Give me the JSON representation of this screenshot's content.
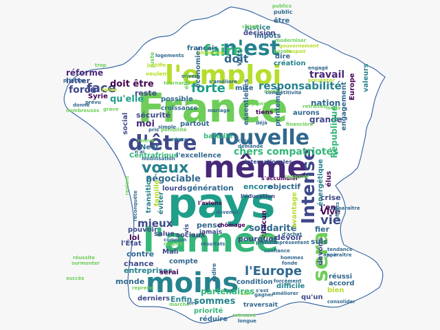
{
  "map": {
    "outline_color": "#3b6aa5",
    "fill": "#ffffff",
    "background": "#f7f7f8"
  },
  "palette": [
    "#440154",
    "#482878",
    "#3e4989",
    "#31688e",
    "#26828e",
    "#1f9e89",
    "#35b779",
    "#6ece58",
    "#b5de2b",
    "#fde725"
  ],
  "words": [
    {
      "text": "France",
      "color": "#6ece58"
    },
    {
      "text": "pays",
      "color": "#1f9e89"
    },
    {
      "text": "l'année",
      "color": "#35b779"
    },
    {
      "text": "même",
      "color": "#482878"
    },
    {
      "text": "l'emploi",
      "color": "#b5de2b"
    },
    {
      "text": "moins",
      "color": "#26828e"
    },
    {
      "text": "nouvelle",
      "color": "#31688e"
    },
    {
      "text": "d'être",
      "color": "#3e4989"
    },
    {
      "text": "n'est",
      "color": "#26828e"
    },
    {
      "text": "sera",
      "color": "#6ece58"
    },
    {
      "text": "Intense",
      "color": "#3e4989"
    },
    {
      "text": "vœux",
      "color": "#26828e"
    },
    {
      "text": "faire",
      "color": "#35b779"
    },
    {
      "text": "face",
      "color": "#3e4989"
    },
    {
      "text": "forte",
      "color": "#1f9e89"
    },
    {
      "text": "doit",
      "color": "#31688e"
    },
    {
      "text": "responsabilité",
      "color": "#26828e"
    },
    {
      "text": "l'Europe",
      "color": "#31688e"
    },
    {
      "text": "chers compatriotes",
      "color": "#35b779"
    },
    {
      "text": "négociable",
      "color": "#31688e"
    },
    {
      "text": "vie",
      "color": "#3e4989"
    },
    {
      "text": "mieux",
      "color": "#3e4989"
    },
    {
      "text": "sommes",
      "color": "#26828e"
    },
    {
      "text": "solidarité",
      "color": "#31688e"
    },
    {
      "text": "partenaires",
      "color": "#35b779"
    },
    {
      "text": "réforme",
      "color": "#482878"
    },
    {
      "text": "doit être",
      "color": "#440154"
    },
    {
      "text": "qu'elle",
      "color": "#1f9e89"
    },
    {
      "text": "force",
      "color": "#3e4989"
    },
    {
      "text": "moi",
      "color": "#482878"
    },
    {
      "text": "travail",
      "color": "#482878"
    },
    {
      "text": "Europe",
      "color": "#440154"
    },
    {
      "text": "nation",
      "color": "#31688e"
    },
    {
      "text": "grande",
      "color": "#3e4989"
    },
    {
      "text": "République",
      "color": "#35b779"
    },
    {
      "text": "sécurité",
      "color": "#3e4989"
    },
    {
      "text": "génération",
      "color": "#31688e"
    },
    {
      "text": "pense",
      "color": "#31688e"
    },
    {
      "text": "pourquoi",
      "color": "#3e4989"
    },
    {
      "text": "encore",
      "color": "#26828e"
    },
    {
      "text": "objectif",
      "color": "#31688e"
    },
    {
      "text": "crise",
      "color": "#3e4989"
    },
    {
      "text": "j'en",
      "color": "#440154"
    },
    {
      "text": "fier",
      "color": "#31688e"
    },
    {
      "text": "Vive",
      "color": "#440154"
    },
    {
      "text": "devoir",
      "color": "#3e4989"
    },
    {
      "text": "suis",
      "color": "#31688e"
    },
    {
      "text": "avantage",
      "color": "#b5de2b"
    },
    {
      "text": "élus",
      "color": "#440154"
    },
    {
      "text": "bataille",
      "color": "#35b779"
    },
    {
      "text": "partout",
      "color": "#31688e"
    },
    {
      "text": "Neuf",
      "color": "#31688e"
    },
    {
      "text": "Centrafrique",
      "color": "#35b779"
    },
    {
      "text": "l'excellence",
      "color": "#31688e"
    },
    {
      "text": "monde",
      "color": "#31688e"
    },
    {
      "text": "Enfin",
      "color": "#26828e"
    },
    {
      "text": "chance",
      "color": "#3e4989"
    },
    {
      "text": "entreprises",
      "color": "#26828e"
    },
    {
      "text": "compte",
      "color": "#31688e"
    },
    {
      "text": "contre",
      "color": "#31688e"
    },
    {
      "text": "loi",
      "color": "#440154"
    },
    {
      "text": "lourds",
      "color": "#3e4989"
    },
    {
      "text": "éviter",
      "color": "#26828e"
    },
    {
      "text": "transition",
      "color": "#26828e"
    },
    {
      "text": "famille",
      "color": "#b5de2b"
    },
    {
      "text": "énergétique",
      "color": "#26828e"
    },
    {
      "text": "chacun",
      "color": "#440154"
    },
    {
      "text": "devons",
      "color": "#3e4989"
    },
    {
      "text": "réussi",
      "color": "#31688e"
    },
    {
      "text": "accord",
      "color": "#31688e"
    },
    {
      "text": "difficile",
      "color": "#26828e"
    },
    {
      "text": "condition",
      "color": "#31688e"
    },
    {
      "text": "qu'un",
      "color": "#3e4989"
    },
    {
      "text": "bien",
      "color": "#b5de2b"
    },
    {
      "text": "derniers",
      "color": "#3e4989"
    },
    {
      "text": "priorité",
      "color": "#35b779"
    },
    {
      "text": "réduire",
      "color": "#31688e"
    },
    {
      "text": "reste",
      "color": "#3e4989"
    },
    {
      "text": "lutter",
      "color": "#3e4989"
    },
    {
      "text": "justice",
      "color": "#26828e"
    },
    {
      "text": "impôts",
      "color": "#31688e"
    },
    {
      "text": "décision",
      "color": "#3e4989"
    },
    {
      "text": "création",
      "color": "#26828e"
    },
    {
      "text": "économies",
      "color": "#31688e"
    },
    {
      "text": "français",
      "color": "#31688e"
    },
    {
      "text": "vers",
      "color": "#31688e"
    },
    {
      "text": "être",
      "color": "#31688e"
    },
    {
      "text": "dire",
      "color": "#31688e"
    },
    {
      "text": "possible",
      "color": "#31688e"
    },
    {
      "text": "social",
      "color": "#3e4989"
    },
    {
      "text": "serai",
      "color": "#440154"
    },
    {
      "text": "salue",
      "color": "#3e4989"
    },
    {
      "text": "Mali",
      "color": "#3e4989"
    },
    {
      "text": "sociaux",
      "color": "#3e4989"
    },
    {
      "text": "aurons",
      "color": "#31688e"
    },
    {
      "text": "essentielles",
      "color": "#31688e"
    },
    {
      "text": "printemps",
      "color": "#31688e"
    },
    {
      "text": "engagement",
      "color": "#31688e"
    },
    {
      "text": "Syrie",
      "color": "#440154"
    },
    {
      "text": "l'État",
      "color": "#3e4989"
    },
    {
      "text": "pouvoir",
      "color": "#3e4989"
    },
    {
      "text": "vis",
      "color": "#3e4989"
    },
    {
      "text": "jamais",
      "color": "#3e4989"
    },
    {
      "text": "l'avions",
      "color": "#440154"
    },
    {
      "text": "l'éducation",
      "color": "#3e4989"
    },
    {
      "text": "internationales",
      "color": "#3e4989"
    },
    {
      "text": "mise",
      "color": "#31688e"
    },
    {
      "text": "valeurs",
      "color": "#26828e"
    },
    {
      "text": "chômage",
      "color": "#440154"
    },
    {
      "text": "croissance",
      "color": "#31688e"
    },
    {
      "text": "public",
      "color": "#31688e"
    },
    {
      "text": "publics",
      "color": "#6ece58"
    },
    {
      "text": "mieux",
      "color": "#26828e"
    },
    {
      "text": "moderniser",
      "color": "#6ece58"
    },
    {
      "text": "gouvernement",
      "color": "#b5de2b"
    },
    {
      "text": "besoin",
      "color": "#6ece58"
    },
    {
      "text": "l'espoir",
      "color": "#b5de2b"
    },
    {
      "text": "engagé",
      "color": "#31688e"
    },
    {
      "text": "présenter",
      "color": "#b5de2b"
    },
    {
      "text": "principe",
      "color": "#31688e"
    },
    {
      "text": "donné",
      "color": "#31688e"
    },
    {
      "text": "trop",
      "color": "#6ece58"
    },
    {
      "text": "grave",
      "color": "#6ece58"
    },
    {
      "text": "nombreuses",
      "color": "#6ece58"
    },
    {
      "text": "retraites",
      "color": "#6ece58"
    },
    {
      "text": "longs",
      "color": "#6ece58"
    },
    {
      "text": "tendance",
      "color": "#31688e"
    },
    {
      "text": "apparaître",
      "color": "#31688e"
    },
    {
      "text": "consolider",
      "color": "#31688e"
    },
    {
      "text": "améliorer",
      "color": "#31688e"
    },
    {
      "text": "forcément",
      "color": "#31688e"
    },
    {
      "text": "marché",
      "color": "#6ece58"
    },
    {
      "text": "reprend",
      "color": "#6ece58"
    },
    {
      "text": "longue",
      "color": "#31688e"
    },
    {
      "text": "retrouvé",
      "color": "#6ece58"
    },
    {
      "text": "traversait",
      "color": "#31688e"
    },
    {
      "text": "soir",
      "color": "#6ece58"
    },
    {
      "text": "financière",
      "color": "#6ece58"
    },
    {
      "text": "tiens",
      "color": "#440154"
    },
    {
      "text": "mariage",
      "color": "#31688e"
    },
    {
      "text": "plans",
      "color": "#6ece58"
    },
    {
      "text": "début",
      "color": "#6ece58"
    },
    {
      "text": "pénibilité",
      "color": "#6ece58"
    },
    {
      "text": "s'accumuler",
      "color": "#440154"
    },
    {
      "text": "représentent",
      "color": "#31688e"
    },
    {
      "text": "d'achat",
      "color": "#31688e"
    },
    {
      "text": "prenant",
      "color": "#31688e"
    },
    {
      "text": "résultats",
      "color": "#31688e"
    },
    {
      "text": "respire",
      "color": "#6ece58"
    },
    {
      "text": "surmonter",
      "color": "#6ece58"
    },
    {
      "text": "commun",
      "color": "#31688e"
    },
    {
      "text": "fonde",
      "color": "#31688e"
    },
    {
      "text": "s'améliore",
      "color": "#31688e"
    },
    {
      "text": "pris",
      "color": "#31688e"
    },
    {
      "text": "simple",
      "color": "#31688e"
    },
    {
      "text": "mobilisation",
      "color": "#31688e"
    },
    {
      "text": "n'ai",
      "color": "#31688e"
    },
    {
      "text": "revient",
      "color": "#6ece58"
    },
    {
      "text": "reconquête",
      "color": "#31688e"
    },
    {
      "text": "efforts",
      "color": "#31688e"
    },
    {
      "text": "regagner",
      "color": "#6ece58"
    },
    {
      "text": "gagner",
      "color": "#31688e"
    },
    {
      "text": "choix",
      "color": "#6ece58"
    },
    {
      "text": "confiance",
      "color": "#31688e"
    },
    {
      "text": "niveau",
      "color": "#6ece58"
    },
    {
      "text": "ouvert",
      "color": "#31688e"
    },
    {
      "text": "tournante",
      "color": "#6ece58"
    },
    {
      "text": "juste",
      "color": "#6ece58"
    },
    {
      "text": "veulent",
      "color": "#b5de2b"
    },
    {
      "text": "chômeurs",
      "color": "#b5de2b"
    },
    {
      "text": "élevé",
      "color": "#6ece58"
    },
    {
      "text": "logements",
      "color": "#31688e"
    },
    {
      "text": "justifie",
      "color": "#b5de2b"
    },
    {
      "text": "faible",
      "color": "#b5de2b"
    },
    {
      "text": "c'était",
      "color": "#6ece58"
    },
    {
      "text": "compétitivité",
      "color": "#31688e"
    },
    {
      "text": "demande",
      "color": "#31688e"
    },
    {
      "text": "créé",
      "color": "#31688e"
    },
    {
      "text": "prévu",
      "color": "#31688e"
    },
    {
      "text": "redire",
      "color": "#31688e"
    },
    {
      "text": "réussite",
      "color": "#6ece58"
    },
    {
      "text": "succès",
      "color": "#6ece58"
    },
    {
      "text": "lors",
      "color": "#31688e"
    },
    {
      "text": "s'est",
      "color": "#31688e"
    },
    {
      "text": "déjà",
      "color": "#31688e"
    },
    {
      "text": "hommes",
      "color": "#31688e"
    },
    {
      "text": "relevé",
      "color": "#6ece58"
    },
    {
      "text": "soir",
      "color": "#31688e"
    },
    {
      "text": "devenus",
      "color": "#31688e"
    },
    {
      "text": "apparaître",
      "color": "#31688e"
    },
    {
      "text": "poids",
      "color": "#6ece58"
    },
    {
      "text": "l'Intense",
      "color": "#31688e"
    }
  ]
}
